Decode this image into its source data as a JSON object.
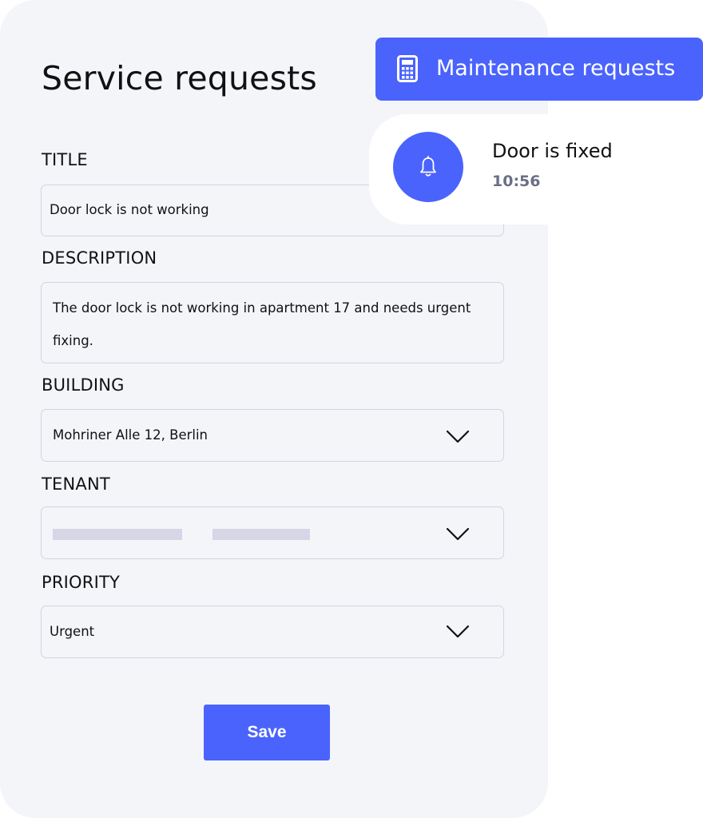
{
  "page": {
    "title": "Service requests"
  },
  "form": {
    "title_label": "TITLE",
    "title_value": "Door lock is not working",
    "description_label": "DESCRIPTION",
    "description_value": "The door lock is not working in apartment 17 and needs urgent fixing.",
    "building_label": "BUILDING",
    "building_value": "Mohriner Alle 12, Berlin",
    "tenant_label": "TENANT",
    "priority_label": "PRIORITY",
    "priority_value": "Urgent",
    "save_label": "Save"
  },
  "banner": {
    "label": "Maintenance requests",
    "icon": "calculator-icon"
  },
  "notification": {
    "title": "Door is fixed",
    "time": "10:56",
    "icon": "bell-icon"
  },
  "colors": {
    "accent": "#4a63fd",
    "card_background": "#f4f5f9",
    "field_border": "#d3d4df",
    "placeholder": "#d6d6e7",
    "muted_text": "#6b6f85"
  }
}
